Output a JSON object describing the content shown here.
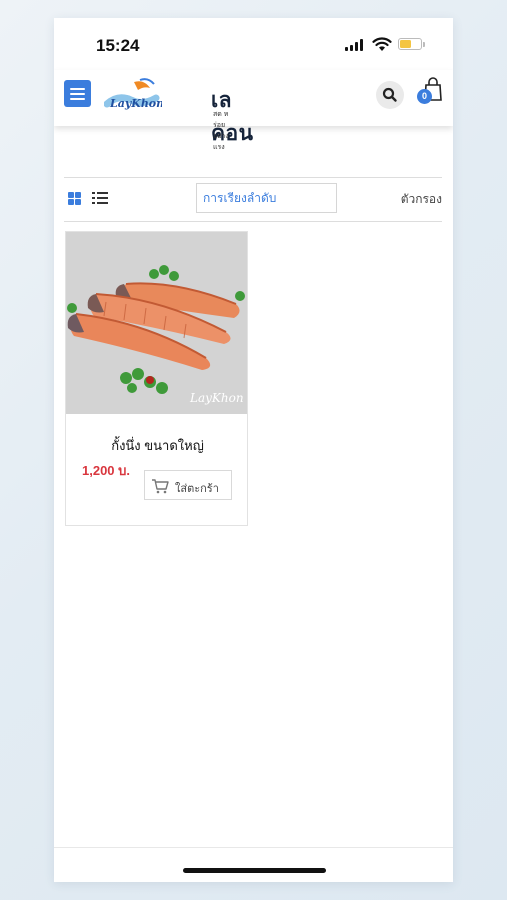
{
  "status_bar": {
    "time": "15:24",
    "battery_color": "#f4c542"
  },
  "header": {
    "brand_name": "เลคอน",
    "tagline": "สด หร่อย อย่างแรง",
    "logo_text": "LayKhon",
    "cart_count": "0",
    "menu_color": "#3b7ddd",
    "cart_badge_color": "#3b7ddd",
    "icons": [
      "menu-icon",
      "search-icon",
      "shopping-bag-icon"
    ]
  },
  "toolbar": {
    "sort_label": "การเรียงลำดับ",
    "filter_label": "ตัวกรอง",
    "view_icons": [
      "grid-view-icon",
      "list-view-icon"
    ],
    "accent_color": "#3b7ddd"
  },
  "products": [
    {
      "name": "กั้งนึ่ง ขนาดใหญ่",
      "price": "1,200 บ.",
      "price_color": "#d9363e",
      "add_to_cart_label": "ใส่ตะกร้า",
      "watermark": "LayKhon"
    }
  ]
}
